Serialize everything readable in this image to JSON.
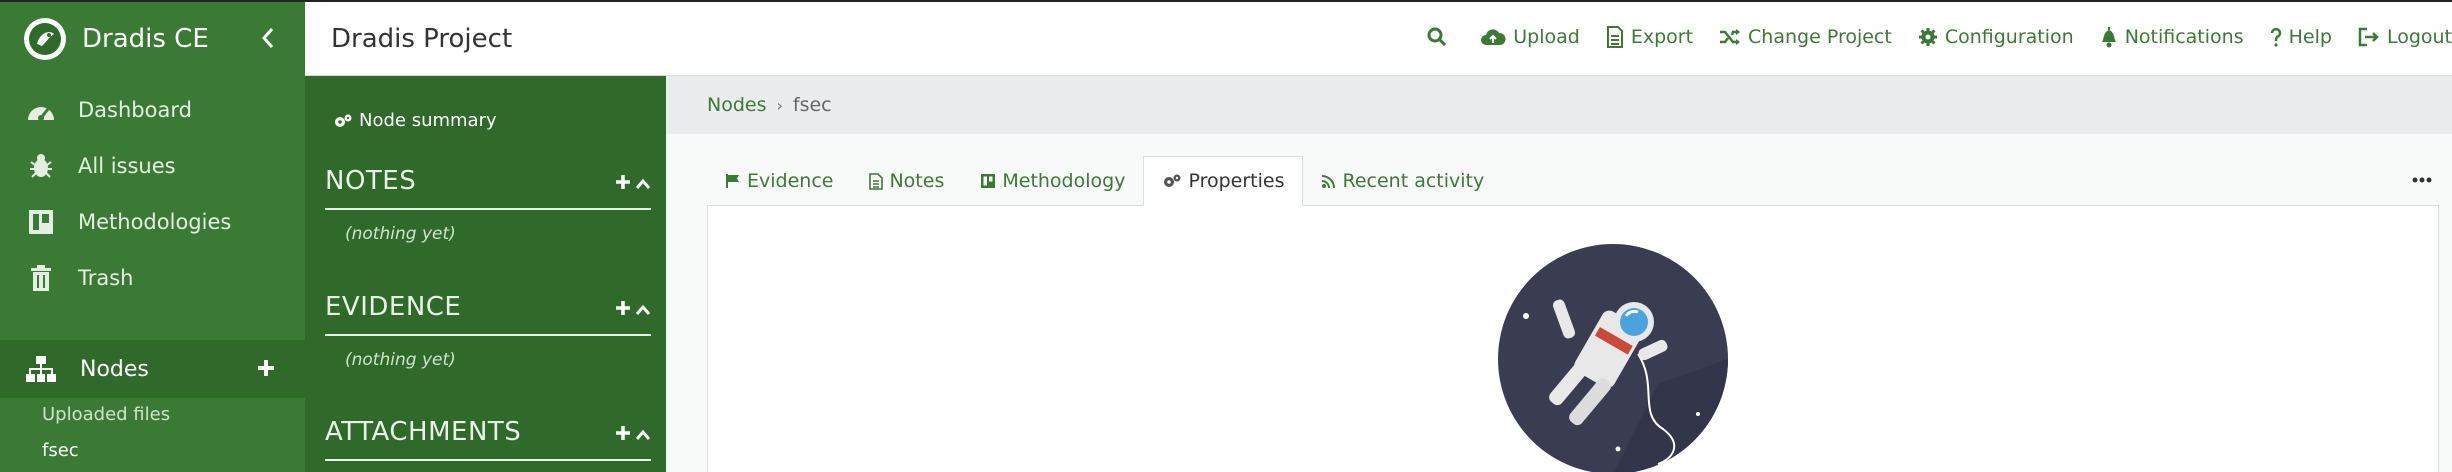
{
  "brand": {
    "name": "Dradis CE"
  },
  "sidebar": {
    "items": [
      {
        "label": "Dashboard",
        "icon": "dashboard-icon"
      },
      {
        "label": "All issues",
        "icon": "bug-icon"
      },
      {
        "label": "Methodologies",
        "icon": "board-icon"
      },
      {
        "label": "Trash",
        "icon": "trash-icon"
      }
    ],
    "nodes_label": "Nodes",
    "subnodes": [
      "Uploaded files",
      "fsec"
    ]
  },
  "header": {
    "project_title": "Dradis Project",
    "nav": [
      "Upload",
      "Export",
      "Change Project",
      "Configuration",
      "Notifications",
      "Help",
      "Logout"
    ]
  },
  "panel": {
    "node_summary": "Node summary",
    "sections": [
      {
        "title": "NOTES",
        "empty": "(nothing yet)"
      },
      {
        "title": "EVIDENCE",
        "empty": "(nothing yet)"
      },
      {
        "title": "ATTACHMENTS"
      }
    ]
  },
  "breadcrumb": {
    "root": "Nodes",
    "current": "fsec"
  },
  "tabs": [
    "Evidence",
    "Notes",
    "Methodology",
    "Properties",
    "Recent activity"
  ],
  "active_tab": "Properties",
  "colors": {
    "sidebar": "#3b7a35",
    "panel": "#2f6a2a",
    "accent": "#3b7a35"
  }
}
